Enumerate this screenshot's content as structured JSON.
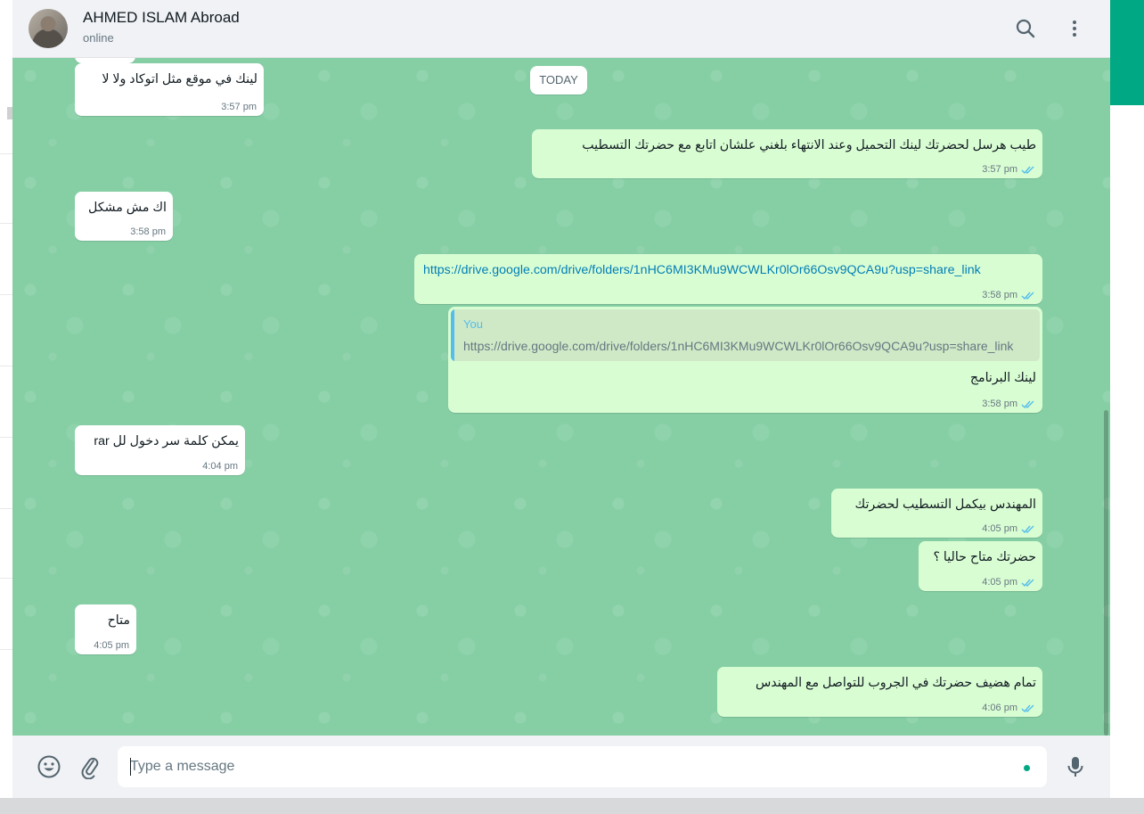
{
  "header": {
    "contact_name": "AHMED ISLAM Abroad",
    "status": "online",
    "search_icon": "search-icon",
    "menu_icon": "kebab-menu-icon"
  },
  "chat": {
    "date_divider": "TODAY",
    "messages": [
      {
        "dir": "in",
        "text": "لينك في موقع مثل اتوكاد ولا لا",
        "time": "3:57 pm"
      },
      {
        "dir": "out",
        "text": "طيب هرسل لحضرتك لينك التحميل وعند الانتهاء بلغني علشان اتابع مع حضرتك التسطيب",
        "time": "3:57 pm",
        "read": true
      },
      {
        "dir": "in",
        "text": "اك مش مشكل",
        "time": "3:58 pm"
      },
      {
        "dir": "out",
        "text": "https://drive.google.com/drive/folders/1nHC6MI3KMu9WCWLKr0lOr66Osv9QCA9u?usp=share_link",
        "time": "3:58 pm",
        "read": true,
        "is_link": true
      },
      {
        "dir": "out",
        "reply_author": "You",
        "reply_text": "https://drive.google.com/drive/folders/1nHC6MI3KMu9WCWLKr0lOr66Osv9QCA9u?usp=share_link",
        "text": "لينك البرنامج",
        "time": "3:58 pm",
        "read": true
      },
      {
        "dir": "in",
        "text": "يمكن كلمة سر دخول لل  rar",
        "time": "4:04 pm"
      },
      {
        "dir": "out",
        "text": "المهندس بيكمل التسطيب لحضرتك",
        "time": "4:05 pm",
        "read": true
      },
      {
        "dir": "out",
        "text": "حضرتك متاح حاليا ؟",
        "time": "4:05 pm",
        "read": true
      },
      {
        "dir": "in",
        "text": "متاح",
        "time": "4:05 pm"
      },
      {
        "dir": "out",
        "text": "تمام هضيف حضرتك في الجروب للتواصل مع المهندس",
        "time": "4:06 pm",
        "read": true
      }
    ]
  },
  "composer": {
    "placeholder": "Type a message",
    "emoji_icon": "emoji-icon",
    "attach_icon": "paperclip-icon",
    "mic_icon": "microphone-icon"
  },
  "colors": {
    "chat_background": "#86cfa5",
    "outgoing_bubble": "#d9fdd3",
    "incoming_bubble": "#ffffff",
    "read_ticks": "#53bdeb",
    "link": "#027eb5",
    "accent": "#00a884"
  }
}
